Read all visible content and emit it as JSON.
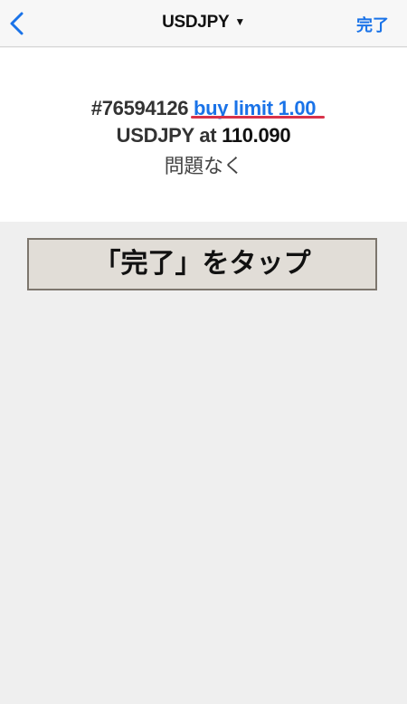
{
  "navbar": {
    "back_icon": "chevron-left-icon",
    "title": "USDJPY",
    "title_caret": "▼",
    "done_label": "完了"
  },
  "result": {
    "order_id": "#76594126",
    "order_type": "buy limit 1.00",
    "symbol_text": "USDJPY at",
    "price": "110.090",
    "status": "問題なく"
  },
  "annotation": {
    "instruction": "「完了」をタップ"
  },
  "colors": {
    "accent": "#1a73e8",
    "underline": "#d9334a",
    "instruction_bg": "#e1ddd7",
    "instruction_border": "#7d766d"
  }
}
